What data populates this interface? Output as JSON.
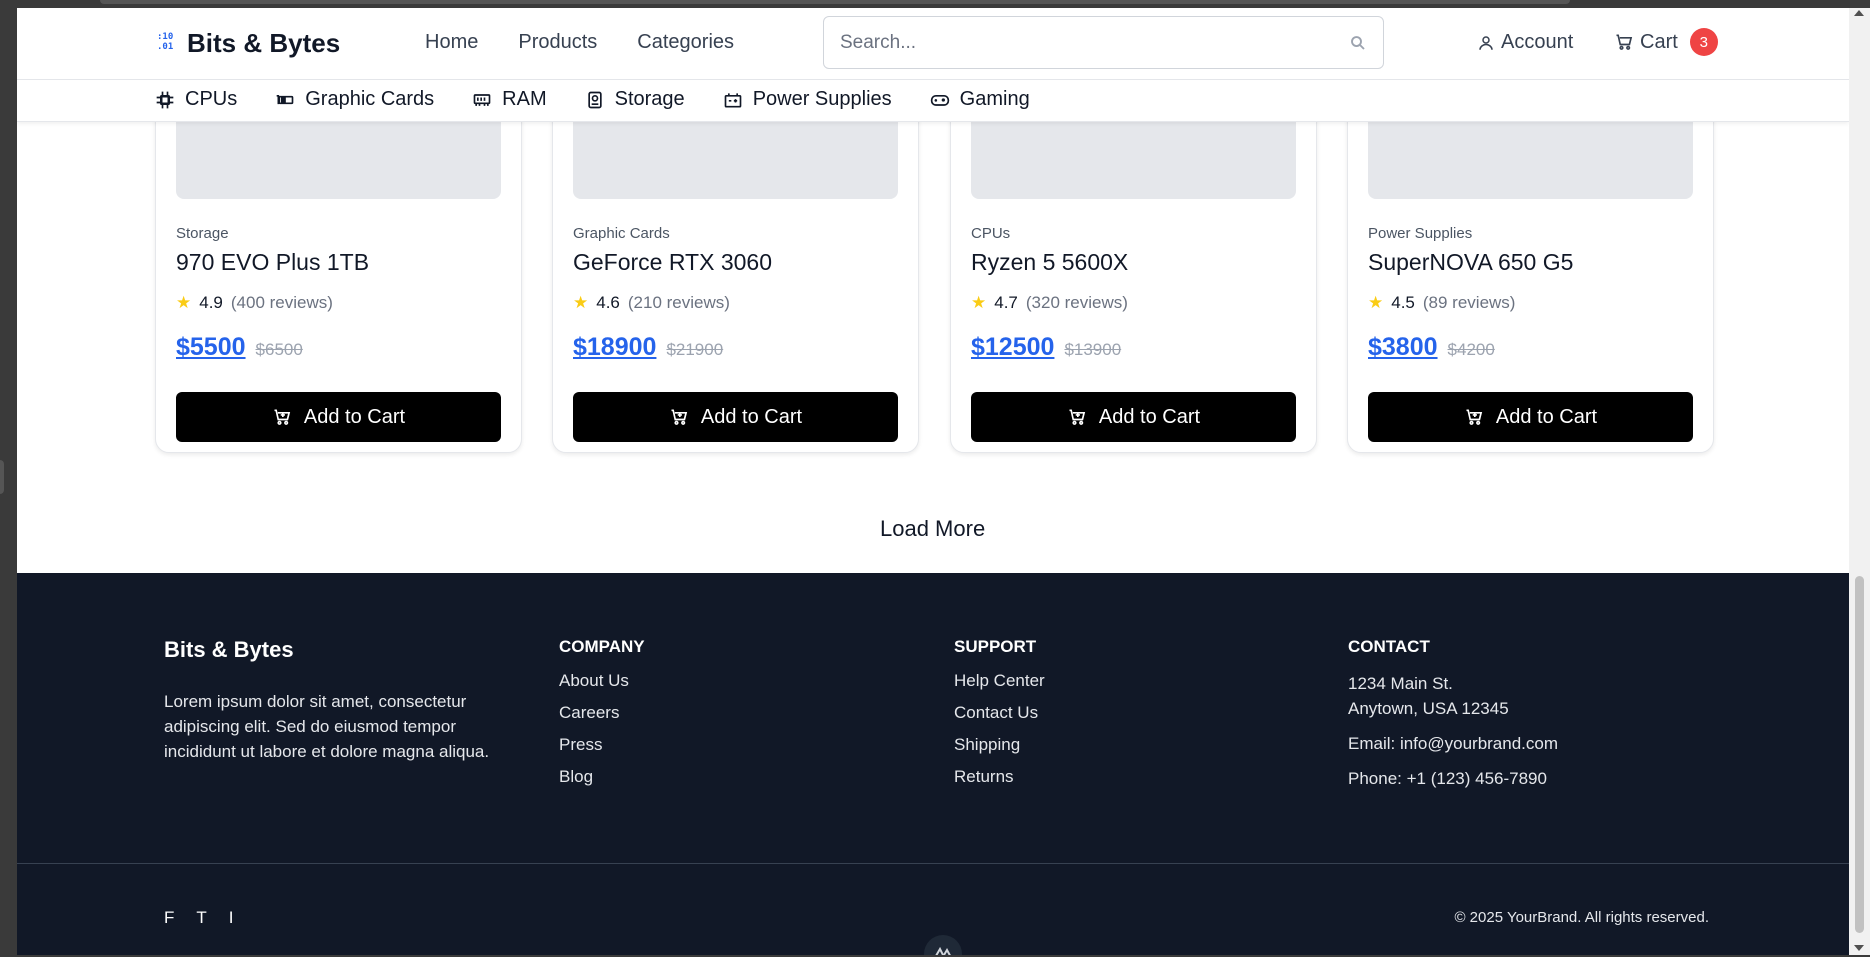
{
  "header": {
    "brand": "Bits & Bytes",
    "logo_glyph_top": ":10",
    "logo_glyph_bottom": ".01",
    "nav": [
      "Home",
      "Products",
      "Categories"
    ],
    "search_placeholder": "Search...",
    "account_label": "Account",
    "cart_label": "Cart",
    "cart_count": "3"
  },
  "categories": [
    {
      "label": "CPUs",
      "icon": "cpu-icon"
    },
    {
      "label": "Graphic Cards",
      "icon": "gpu-icon"
    },
    {
      "label": "RAM",
      "icon": "memory-icon"
    },
    {
      "label": "Storage",
      "icon": "storage-icon"
    },
    {
      "label": "Power Supplies",
      "icon": "power-supply-icon"
    },
    {
      "label": "Gaming",
      "icon": "gamepad-icon"
    }
  ],
  "products": [
    {
      "category": "Storage",
      "name": "970 EVO Plus 1TB",
      "rating": "4.9",
      "reviews": "(400 reviews)",
      "price": "$5500",
      "old_price": "$6500",
      "button": "Add to Cart"
    },
    {
      "category": "Graphic Cards",
      "name": "GeForce RTX 3060",
      "rating": "4.6",
      "reviews": "(210 reviews)",
      "price": "$18900",
      "old_price": "$21900",
      "button": "Add to Cart"
    },
    {
      "category": "CPUs",
      "name": "Ryzen 5 5600X",
      "rating": "4.7",
      "reviews": "(320 reviews)",
      "price": "$12500",
      "old_price": "$13900",
      "button": "Add to Cart"
    },
    {
      "category": "Power Supplies",
      "name": "SuperNOVA 650 G5",
      "rating": "4.5",
      "reviews": "(89 reviews)",
      "price": "$3800",
      "old_price": "$4200",
      "button": "Add to Cart"
    }
  ],
  "load_more": "Load More",
  "footer": {
    "brand": "Bits & Bytes",
    "description": "Lorem ipsum dolor sit amet, consectetur adipiscing elit. Sed do eiusmod tempor incididunt ut labore et dolore magna aliqua.",
    "company": {
      "title": "COMPANY",
      "links": [
        "About Us",
        "Careers",
        "Press",
        "Blog"
      ]
    },
    "support": {
      "title": "SUPPORT",
      "links": [
        "Help Center",
        "Contact Us",
        "Shipping",
        "Returns"
      ]
    },
    "contact": {
      "title": "CONTACT",
      "address_line1": "1234 Main St.",
      "address_line2": "Anytown, USA 12345",
      "email": "Email: info@yourbrand.com",
      "phone": "Phone: +1 (123) 456-7890"
    },
    "social": [
      "F",
      "T",
      "I"
    ],
    "copyright": "© 2025 YourBrand. All rights reserved."
  },
  "colors": {
    "accent": "#2563eb",
    "badge": "#ef4444",
    "footer_bg": "#111827",
    "star": "#facc15"
  }
}
